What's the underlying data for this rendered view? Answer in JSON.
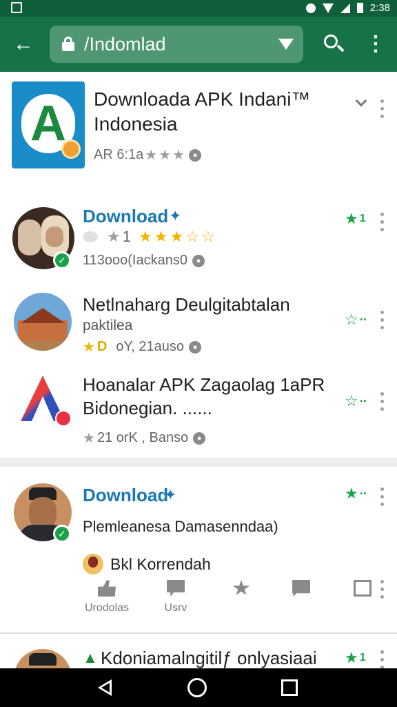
{
  "status_bar": {
    "time": "2:38"
  },
  "app_bar": {
    "search_text": "/Indomlad"
  },
  "hero": {
    "title": "Downloada APK Indani™ Indonesia",
    "meta_text": "AR 6:1a",
    "icon_letter": "A"
  },
  "items": [
    {
      "title": "Download",
      "rating_num": "1",
      "meta": "113ooo(Iackans0",
      "trail_count": "1"
    },
    {
      "title": "Netlnaharg Deulgitabtalan",
      "subtitle": "paktilea",
      "meta_d": "D",
      "meta": "oY, 21auso"
    },
    {
      "title": "Hoanalar APK Zagaolag 1aPR Bidonegian.  ......",
      "meta": "21 orK ,  Banso"
    }
  ],
  "post": {
    "title": "Download",
    "text": "Plemleanesa Damasenndaa)",
    "comment_author": "Bkl Korrendah",
    "actions": [
      {
        "label": "Urodolas"
      },
      {
        "label": "Usrv"
      },
      {
        "label": ""
      },
      {
        "label": ""
      },
      {
        "label": ""
      }
    ]
  },
  "next_item": {
    "title": "Kdoniamalngitilƒ onlyasiaai",
    "trail_count": "1"
  },
  "colors": {
    "app_bar": "#157347",
    "status_bar": "#0f5f3a",
    "accent_blue": "#1a78b4",
    "accent_green": "#16a34a",
    "star_gold": "#f2b400"
  }
}
